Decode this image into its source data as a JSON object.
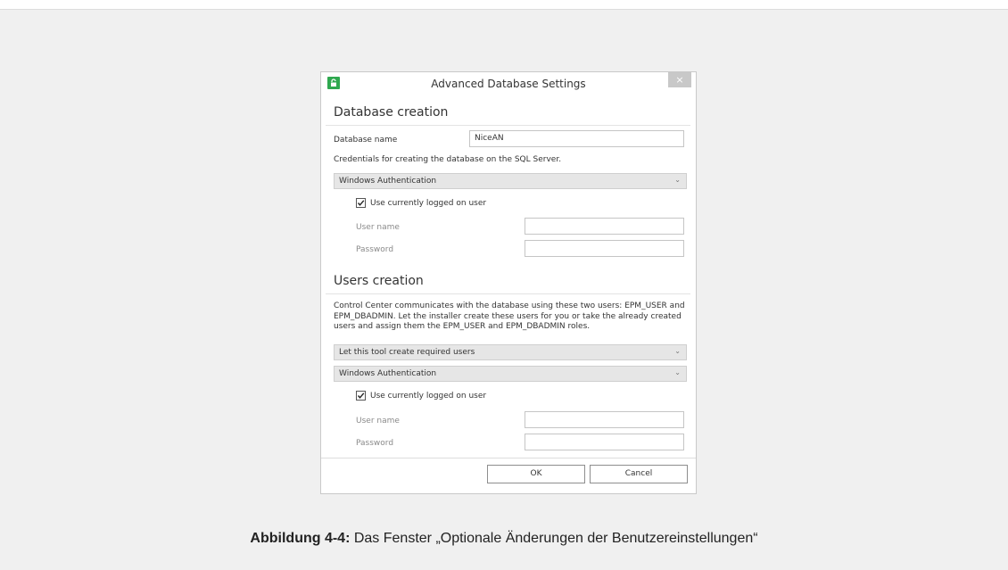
{
  "dialog": {
    "title": "Advanced Database Settings",
    "close_glyph": "×",
    "icon": "lock-icon",
    "db_section": {
      "title": "Database creation",
      "name_label": "Database name",
      "name_value": "NiceAN",
      "credentials_text": "Credentials for creating the database on the SQL Server.",
      "auth_select": "Windows Authentication",
      "use_current_label": "Use currently logged on user",
      "use_current_checked": true,
      "user_label": "User name",
      "password_label": "Password"
    },
    "users_section": {
      "title": "Users creation",
      "description": "Control Center communicates with the database using these two users: EPM_USER and EPM_DBADMIN. Let the installer create these users for you or take the already created users and assign them the EPM_USER and EPM_DBADMIN roles.",
      "mode_select": "Let this tool create required users",
      "auth_select": "Windows Authentication",
      "use_current_label": "Use currently logged on user",
      "use_current_checked": true,
      "user_label": "User name",
      "password_label": "Password"
    },
    "ok_label": "OK",
    "cancel_label": "Cancel"
  },
  "caption": {
    "bold": "Abbildung 4-4:",
    "text": " Das Fenster „Optionale Änderungen der Benutzereinstellungen“"
  },
  "colors": {
    "panel_bg": "#f0f0f0",
    "icon_green": "#2fa84f",
    "select_bg": "#e6e6e6"
  }
}
